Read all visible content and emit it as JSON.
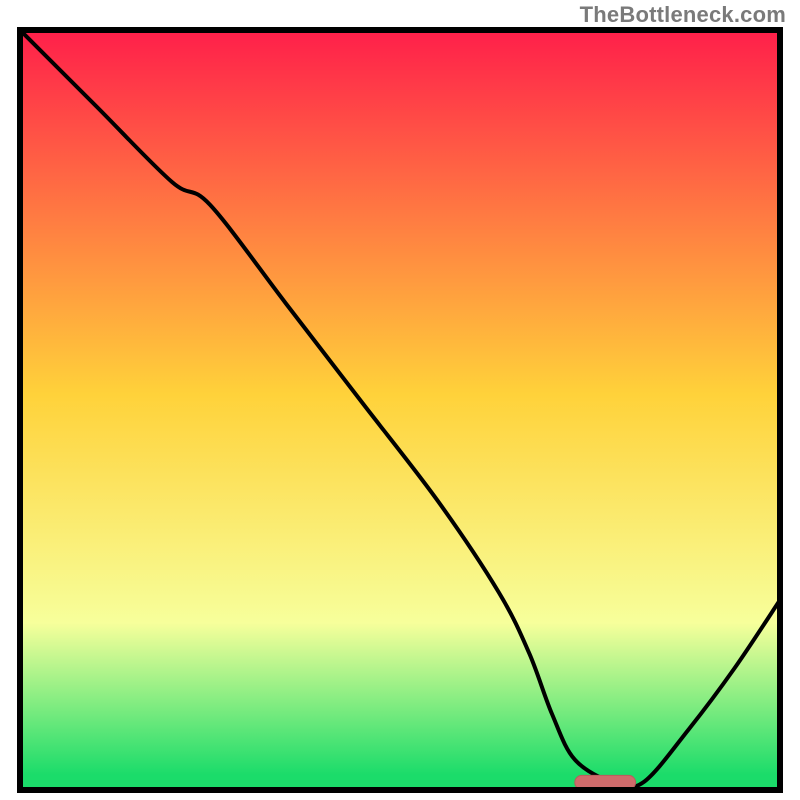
{
  "watermark": "TheBottleneck.com",
  "colors": {
    "gradient_top": "#ff1f4a",
    "gradient_mid": "#ffd23a",
    "gradient_low": "#f7ff9b",
    "gradient_bottom": "#1bdc6a",
    "frame": "#000000",
    "curve": "#000000",
    "marker_fill": "#cf6b6b",
    "marker_stroke": "#b85c5c"
  },
  "plot": {
    "outer_w": 800,
    "outer_h": 800,
    "inner_x": 20,
    "inner_y": 30,
    "inner_w": 760,
    "inner_h": 760,
    "frame_stroke_w": 6
  },
  "chart_data": {
    "type": "line",
    "title": "",
    "xlabel": "",
    "ylabel": "",
    "xlim": [
      0,
      100
    ],
    "ylim": [
      0,
      100
    ],
    "grid": false,
    "annotations": [],
    "series": [
      {
        "name": "bottleneck-curve",
        "x": [
          0,
          10,
          20,
          25,
          35,
          45,
          55,
          63,
          67,
          70,
          73,
          78,
          82,
          88,
          94,
          100
        ],
        "y": [
          100,
          90,
          80,
          77,
          64,
          51,
          38,
          26,
          18,
          10,
          4,
          1,
          1,
          8,
          16,
          25
        ]
      }
    ],
    "marker": {
      "name": "optimal-range",
      "x_start": 73,
      "x_end": 81,
      "y": 1
    }
  }
}
